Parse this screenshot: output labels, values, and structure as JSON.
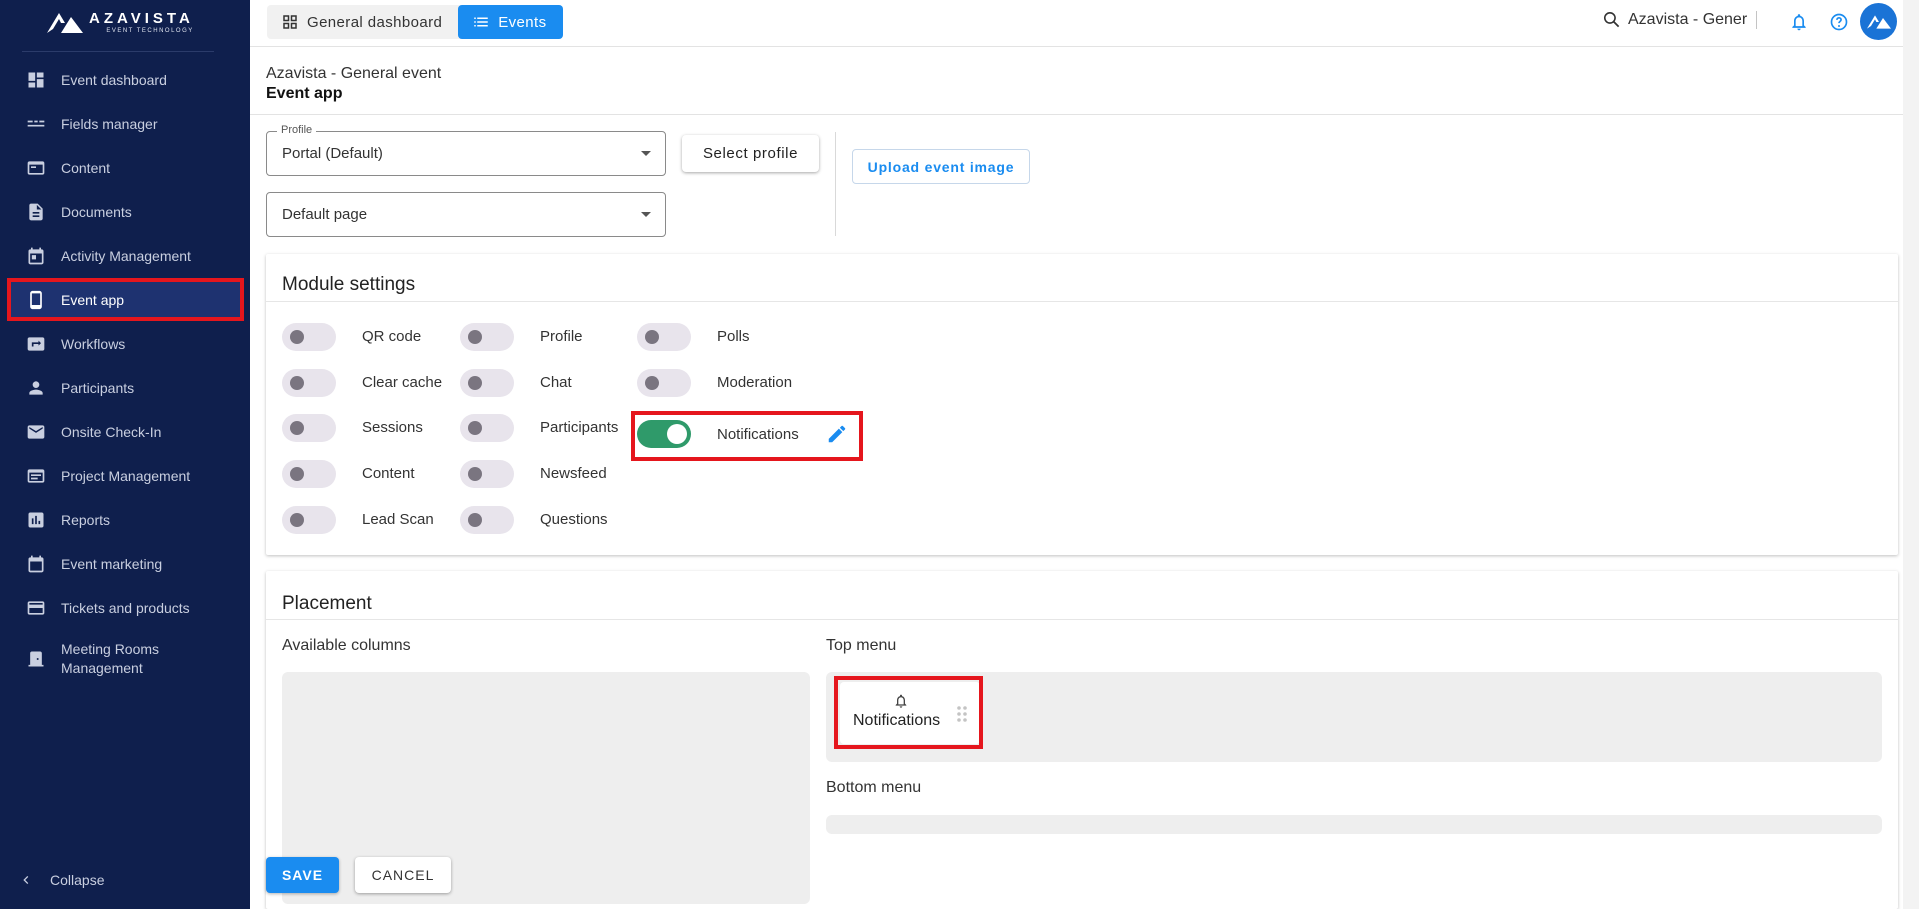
{
  "brand": {
    "title": "AZAVISTA",
    "subtitle": "EVENT TECHNOLOGY"
  },
  "sidebar": {
    "items": [
      {
        "label": "Event dashboard",
        "icon": "dashboard-icon"
      },
      {
        "label": "Fields manager",
        "icon": "fields-icon"
      },
      {
        "label": "Content",
        "icon": "content-icon"
      },
      {
        "label": "Documents",
        "icon": "document-icon"
      },
      {
        "label": "Activity Management",
        "icon": "calendar-icon"
      },
      {
        "label": "Event app",
        "icon": "phone-icon",
        "active": true
      },
      {
        "label": "Workflows",
        "icon": "workflow-icon"
      },
      {
        "label": "Participants",
        "icon": "person-icon"
      },
      {
        "label": "Onsite Check-In",
        "icon": "mail-icon"
      },
      {
        "label": "Project Management",
        "icon": "project-icon"
      },
      {
        "label": "Reports",
        "icon": "reports-icon"
      },
      {
        "label": "Event marketing",
        "icon": "marketing-calendar-icon"
      },
      {
        "label": "Tickets and products",
        "icon": "card-icon"
      },
      {
        "label": "Meeting Rooms Management",
        "icon": "door-icon"
      }
    ],
    "collapse_label": "Collapse"
  },
  "topbar": {
    "tabs": [
      {
        "label": "General dashboard",
        "icon": "grid-icon"
      },
      {
        "label": "Events",
        "icon": "list-icon",
        "active": true
      }
    ],
    "search_text": "Azavista - Gener"
  },
  "header": {
    "breadcrumb": "Azavista - General event",
    "title": "Event app"
  },
  "profile": {
    "label": "Profile",
    "selected": "Portal (Default)",
    "default_page": "Default page",
    "select_button": "Select profile",
    "upload_button": "Upload event image"
  },
  "modules": {
    "title": "Module settings",
    "items": [
      {
        "label": "QR code",
        "on": false
      },
      {
        "label": "Clear cache",
        "on": false
      },
      {
        "label": "Sessions",
        "on": false
      },
      {
        "label": "Content",
        "on": false
      },
      {
        "label": "Lead Scan",
        "on": false
      },
      {
        "label": "Profile",
        "on": false
      },
      {
        "label": "Chat",
        "on": false
      },
      {
        "label": "Participants",
        "on": false
      },
      {
        "label": "Newsfeed",
        "on": false
      },
      {
        "label": "Questions",
        "on": false
      },
      {
        "label": "Polls",
        "on": false
      },
      {
        "label": "Moderation",
        "on": false
      },
      {
        "label": "Notifications",
        "on": true
      }
    ]
  },
  "placement": {
    "title": "Placement",
    "available_columns": "Available columns",
    "top_menu": "Top menu",
    "bottom_menu": "Bottom menu",
    "top_menu_items": [
      {
        "label": "Notifications",
        "icon": "bell-icon"
      }
    ]
  },
  "actions": {
    "save": "SAVE",
    "cancel": "CANCEL"
  },
  "colors": {
    "sidebar": "#0f1f4d",
    "accent": "#1a8cf0",
    "toggle_on": "#2f9a6a",
    "highlight": "#e5161d"
  }
}
